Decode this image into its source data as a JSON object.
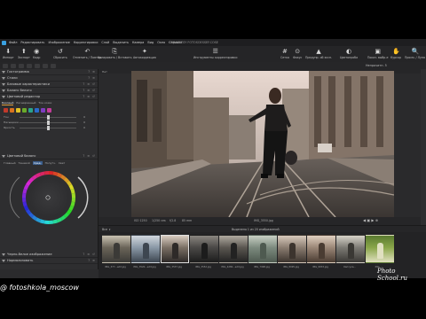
{
  "menubar": {
    "items": [
      "Файл",
      "Редактировать",
      "Изображение",
      "Корректировки",
      "Слой",
      "Выделить",
      "Камера",
      "Вид",
      "Окно",
      "Справка"
    ],
    "window_title": "OBRAZETSY FOTOSOESSEF.COSE"
  },
  "toolbar": {
    "left": [
      {
        "icon": "import-icon",
        "label": "Импорт"
      },
      {
        "icon": "export-icon",
        "label": "Экспорт"
      },
      {
        "icon": "capture-icon",
        "label": "Кадр"
      },
      {
        "icon": "reset-icon",
        "label": "Сбросить"
      },
      {
        "icon": "undo-redo-icon",
        "label": "Отменить / Повтор."
      },
      {
        "icon": "copy-icon",
        "label": "Копировать / Вставить"
      },
      {
        "icon": "local-adjustments-icon",
        "label": "Автокоррекция"
      },
      {
        "icon": "presets-icon",
        "label": "Инструменты корректировки"
      }
    ],
    "right": [
      {
        "icon": "grid-icon",
        "label": "Сетка"
      },
      {
        "icon": "focus-icon",
        "label": "Фокус"
      },
      {
        "icon": "proof-icon",
        "label": "Предупр. об эксп."
      },
      {
        "icon": "color-icon",
        "label": "Цветопроба"
      },
      {
        "icon": "show-selection-icon",
        "label": "Показ. выбр-е"
      },
      {
        "icon": "scroll-icon",
        "label": "Курсор"
      },
      {
        "icon": "loupe-icon",
        "label": "Просм. / Лупа"
      }
    ]
  },
  "toolrow": {
    "zoom_value": "Непрочитн. 5"
  },
  "left_panel": {
    "tools_title": "Гистограмма",
    "panels": [
      "Гистограмма",
      "Стили",
      "Базовые характеристики",
      "Баланс белого",
      "Цветовой редактор"
    ],
    "color_editor": {
      "tabs": [
        "Базовый",
        "Расширенный",
        "Тон кожи"
      ],
      "active_tab": "Базовый",
      "swatch_colors": [
        "#c0392b",
        "#d9731f",
        "#e0c228",
        "#6aaa2a",
        "#2aa38c",
        "#2a6acb",
        "#7d3ec0",
        "#c23c9a"
      ],
      "sliders": [
        {
          "label": "Тон",
          "value": "0",
          "level": 0.5
        },
        {
          "label": "Насыщенн.",
          "value": "0",
          "level": 0.5
        },
        {
          "label": "Яркость",
          "value": "0",
          "level": 0.5
        }
      ]
    },
    "color_balance": {
      "title": "Цветовой баланс",
      "tabs": [
        "Главный",
        "Теневой",
        "Сред.",
        "Полутч.",
        "Свет"
      ],
      "active_tab": "Сред."
    },
    "bottom_panels": [
      "Черно-белое изображение",
      "Нормализовать"
    ]
  },
  "viewer": {
    "top_left": "Нет",
    "info": [
      "ISO 1250",
      "1/250 сек",
      "f/2.8",
      "85 mm"
    ],
    "filename": "IMG_3550.jpg"
  },
  "browser": {
    "filter": "Все",
    "selection_status": "Выделено 1 из 20 изображений",
    "thumbnails": [
      {
        "caption": "IMG_377...edit.jpg",
        "colors": [
          "#6a6458",
          "#3b3a37",
          "#c9c2b2"
        ],
        "selected": false
      },
      {
        "caption": "IMG_3520...edit.jpg",
        "colors": [
          "#8a98a6",
          "#3d4650",
          "#d2d8de"
        ],
        "selected": false
      },
      {
        "caption": "IMG_3537.jpg",
        "colors": [
          "#7a6f64",
          "#2e2a28",
          "#d8ccc0"
        ],
        "selected": true
      },
      {
        "caption": "IMG_3552.jpg",
        "colors": [
          "#4a4846",
          "#1c1c1c",
          "#8a8680"
        ],
        "selected": false
      },
      {
        "caption": "IMG_4280...edit.jpg",
        "colors": [
          "#5a5650",
          "#222",
          "#b0aaa0"
        ],
        "selected": false
      },
      {
        "caption": "IMG_7998.jpg",
        "colors": [
          "#7c8a7e",
          "#4e5a50",
          "#c8d0c4"
        ],
        "selected": false
      },
      {
        "caption": "IMG_8095.jpg",
        "colors": [
          "#8a7c70",
          "#3c342e",
          "#d8cabc"
        ],
        "selected": false
      },
      {
        "caption": "IMG_9833.jpg",
        "colors": [
          "#9a8676",
          "#4a3c32",
          "#e0d0c0"
        ],
        "selected": false
      },
      {
        "caption": "Капсула...",
        "colors": [
          "#7c7a74",
          "#3a3834",
          "#d6d2c8"
        ],
        "selected": false
      },
      {
        "caption": "IMG_...",
        "colors": [
          "#8aa64a",
          "#e0e0c0",
          "#5a7a30"
        ],
        "selected": false
      }
    ]
  },
  "overlay": {
    "handle": "@ fotoshkola_moscow",
    "watermark": "Photo School.ru"
  }
}
